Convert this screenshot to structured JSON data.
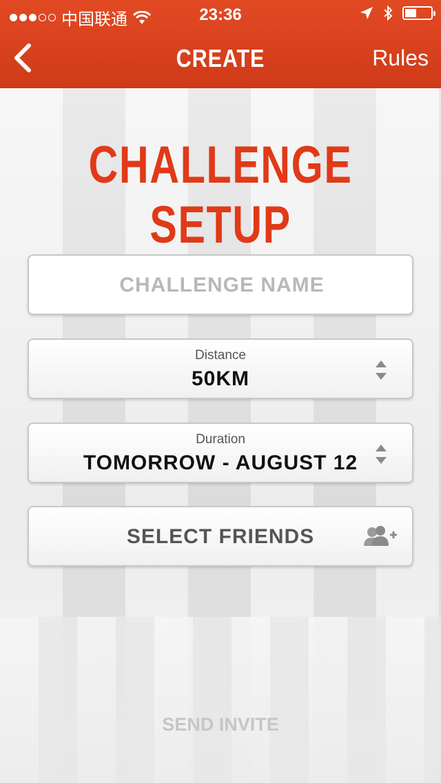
{
  "status_bar": {
    "carrier": "中国联通",
    "time": "23:36"
  },
  "nav": {
    "title": "CREATE",
    "right_label": "Rules"
  },
  "heading": "CHALLENGE SETUP",
  "name_field": {
    "placeholder": "CHALLENGE NAME",
    "value": ""
  },
  "distance": {
    "label": "Distance",
    "value": "50KM"
  },
  "duration": {
    "label": "Duration",
    "value": "TOMORROW - AUGUST 12"
  },
  "friends": {
    "label": "SELECT FRIENDS"
  },
  "send_invite": "SEND INVITE",
  "colors": {
    "accent": "#e03a18",
    "navbar": "#d64020"
  },
  "icons": [
    "wifi-icon",
    "location-arrow-icon",
    "bluetooth-icon",
    "battery-icon",
    "back-chevron-icon",
    "stepper-arrows-icon",
    "add-friends-icon"
  ]
}
